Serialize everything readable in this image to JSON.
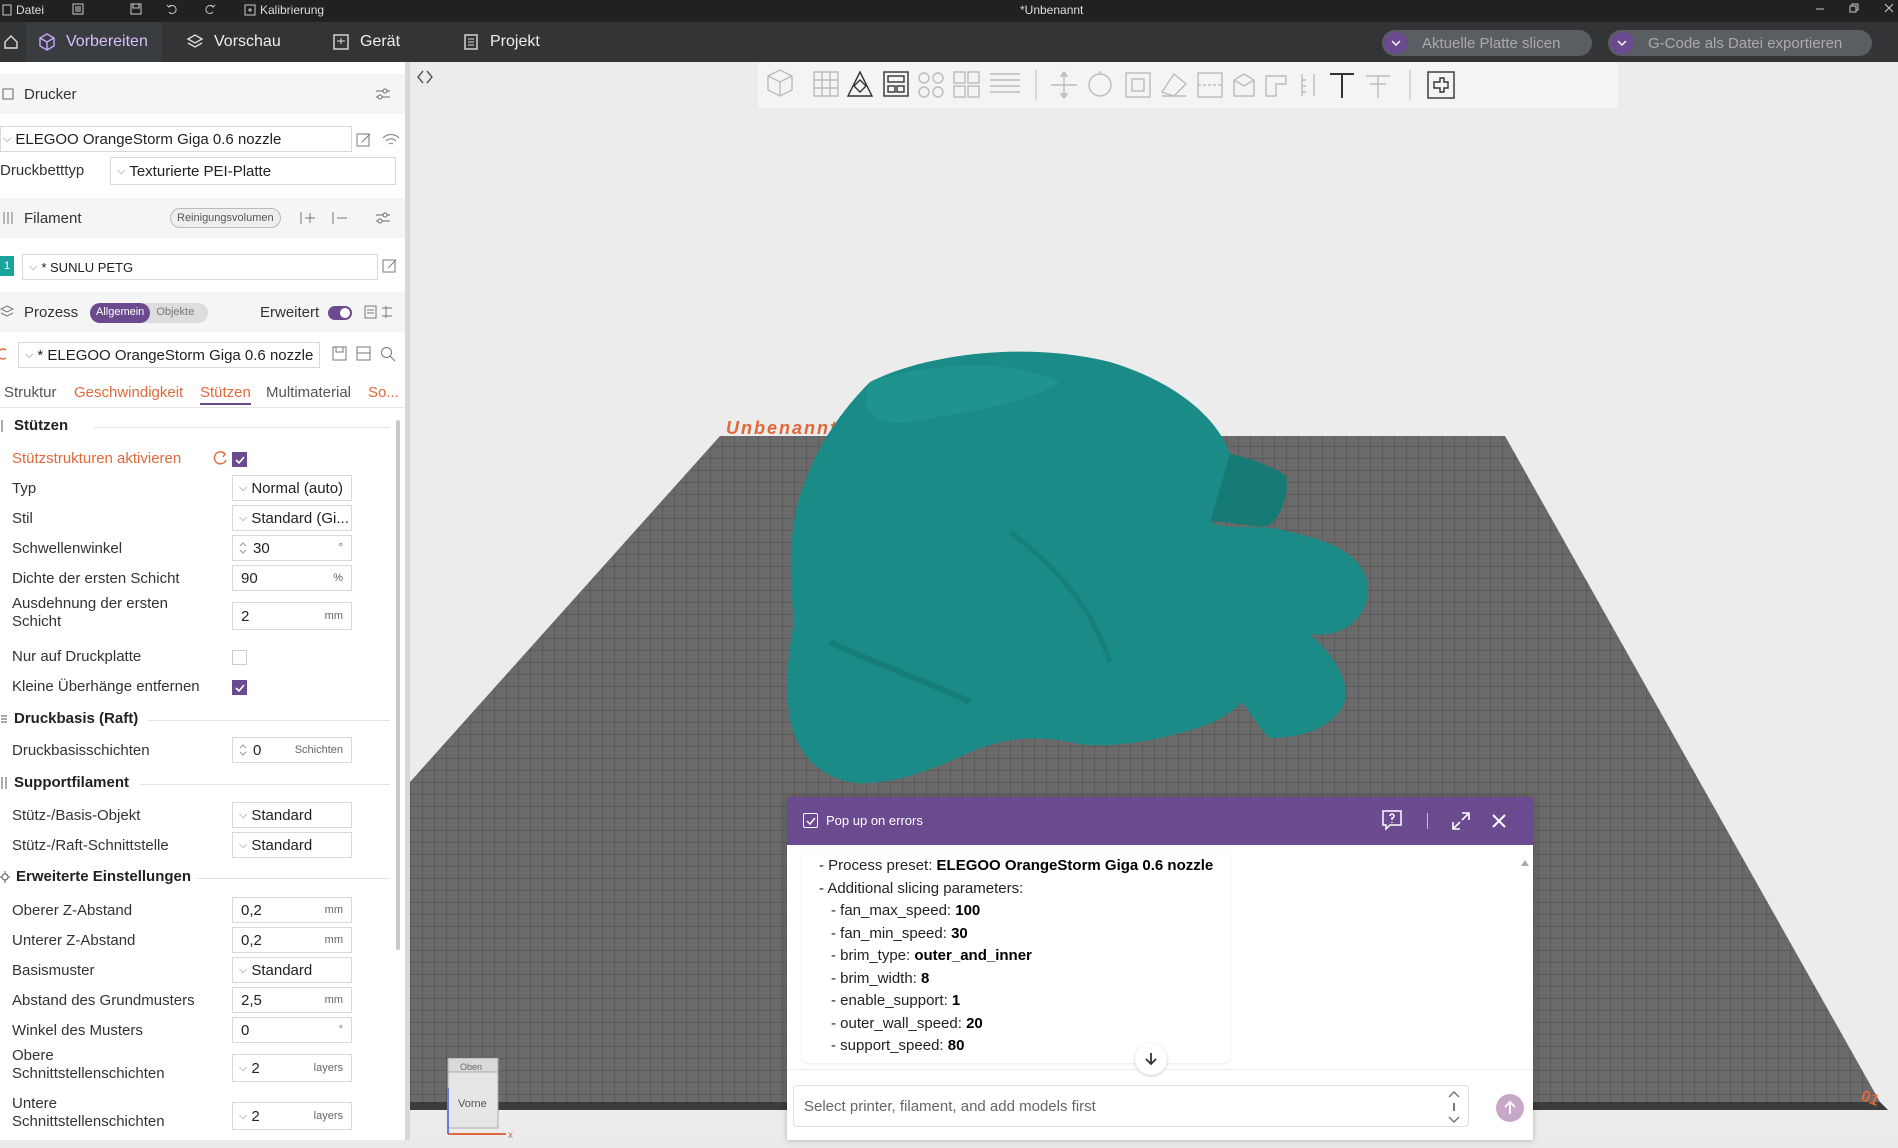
{
  "titlebar": {
    "file_menu": "Datei",
    "calibration": "Kalibrierung",
    "doc_title": "*Unbenannt"
  },
  "tabs": {
    "prepare": "Vorbereiten",
    "preview": "Vorschau",
    "device": "Gerät",
    "project": "Projekt"
  },
  "actions": {
    "slice": "Aktuelle Platte slicen",
    "export": "G-Code als Datei exportieren"
  },
  "printer": {
    "header": "Drucker",
    "name": "ELEGOO OrangeStorm Giga 0.6 nozzle",
    "bed_label": "Druckbetttyp",
    "bed_value": "Texturierte PEI-Platte"
  },
  "filament": {
    "header": "Filament",
    "purge_button": "Reinigungsvolumen",
    "slot_number": "1",
    "name": "* SUNLU PETG"
  },
  "process": {
    "header": "Prozess",
    "toggle_global": "Allgemein",
    "toggle_objects": "Objekte",
    "advanced_label": "Erweitert",
    "preset": "* ELEGOO OrangeStorm Giga 0.6 nozzle"
  },
  "subtabs": [
    "Struktur",
    "Geschwindigkeit",
    "Stützen",
    "Multimaterial",
    "So..."
  ],
  "groups": {
    "supports": "Stützen",
    "raft": "Druckbasis (Raft)",
    "support_filament": "Supportfilament",
    "advanced": "Erweiterte Einstellungen"
  },
  "settings": {
    "enable_support": "Stützstrukturen aktivieren",
    "type_label": "Typ",
    "type_value": "Normal (auto)",
    "style_label": "Stil",
    "style_value": "Standard (Gi...",
    "threshold_label": "Schwellenwinkel",
    "threshold_value": "30",
    "threshold_unit": "°",
    "first_density_label": "Dichte der ersten Schicht",
    "first_density_value": "90",
    "first_density_unit": "%",
    "first_expansion_label_1": "Ausdehnung der ersten",
    "first_expansion_label_2": "Schicht",
    "first_expansion_value": "2",
    "first_expansion_unit": "mm",
    "buildplate_only_label": "Nur auf Druckplatte",
    "remove_small_label": "Kleine Überhänge entfernen",
    "raft_layers_label": "Druckbasisschichten",
    "raft_layers_value": "0",
    "raft_layers_unit": "Schichten",
    "support_base_label": "Stütz-/Basis-Objekt",
    "support_base_value": "Standard",
    "support_interface_label": "Stütz-/Raft-Schnittstelle",
    "support_interface_value": "Standard",
    "top_z_label": "Oberer Z-Abstand",
    "top_z_value": "0,2",
    "top_z_unit": "mm",
    "bottom_z_label": "Unterer Z-Abstand",
    "bottom_z_value": "0,2",
    "bottom_z_unit": "mm",
    "base_pattern_label": "Basismuster",
    "base_pattern_value": "Standard",
    "base_spacing_label": "Abstand des Grundmusters",
    "base_spacing_value": "2,5",
    "base_spacing_unit": "mm",
    "pattern_angle_label": "Winkel des Musters",
    "pattern_angle_value": "0",
    "pattern_angle_unit": "°",
    "top_interface_label_1": "Obere",
    "top_interface_label_2": "Schnittstellenschichten",
    "top_interface_value": "2",
    "top_interface_unit": "layers",
    "bottom_interface_label_1": "Untere",
    "bottom_interface_label_2": "Schnittstellenschichten",
    "bottom_interface_value": "2",
    "bottom_interface_unit": "layers"
  },
  "plate": {
    "name": "Unbenannt",
    "number": "01"
  },
  "orient_cube": {
    "top": "Oben",
    "front": "Vorne",
    "x_axis": "x"
  },
  "log": {
    "popup_label": "Pop up on errors",
    "input_placeholder": "Select printer, filament, and add models first",
    "lines": [
      {
        "key": "- Process preset: ",
        "val": "ELEGOO OrangeStorm Giga 0.6 nozzle"
      },
      {
        "key": "- Additional slicing parameters:",
        "val": ""
      },
      {
        "key": "- fan_max_speed: ",
        "val": "100"
      },
      {
        "key": "- fan_min_speed: ",
        "val": "30"
      },
      {
        "key": "- brim_type: ",
        "val": "outer_and_inner"
      },
      {
        "key": "- brim_width: ",
        "val": "8"
      },
      {
        "key": "- enable_support: ",
        "val": "1"
      },
      {
        "key": "- outer_wall_speed: ",
        "val": "20"
      },
      {
        "key": "- support_speed: ",
        "val": "80"
      }
    ]
  },
  "colors": {
    "accent": "#6b4a8f",
    "model": "#1a8b86",
    "orange": "#e0683a",
    "grid": "#555555"
  }
}
